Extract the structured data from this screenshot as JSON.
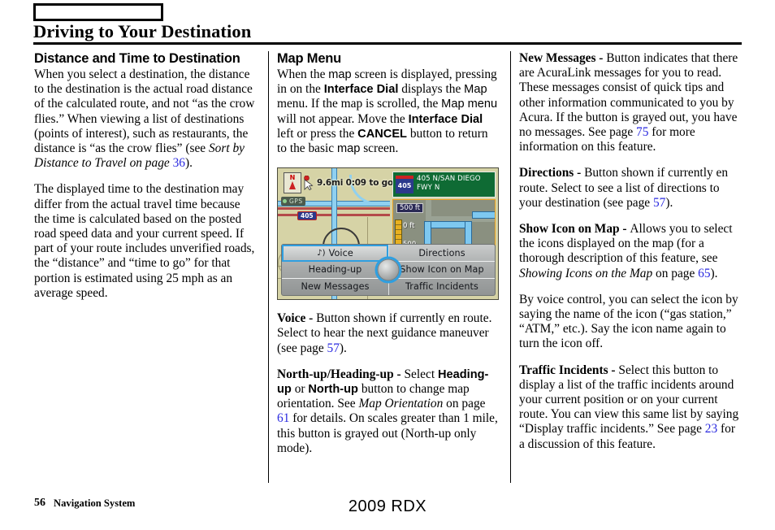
{
  "header": {
    "tab_marker_label": "",
    "title": "Driving to Your Destination"
  },
  "columns": {
    "left": {
      "heading": "Distance and Time to Destination",
      "para1_a": "When you select a destination, the distance to the destination is the actual road distance of the calculated route, and not “as the crow flies.” When viewing a list of destinations (points of interest), such as restaurants, the distance is “as the crow flies” (see ",
      "para1_italic": "Sort by Distance to Travel",
      "para1_b": " on page ",
      "para1_page": "36",
      "para1_c": ").",
      "para2": "The displayed time to the destination may differ from the actual travel time because the time is calculated based on the posted road speed data and your current speed. If part of your route includes unverified roads, the “distance” and “time to go” for that portion is estimated using 25 mph as an average speed."
    },
    "middle": {
      "heading": "Map Menu",
      "intro_1": "When the ",
      "intro_map1": "map",
      "intro_2": " screen is displayed, pressing in on the ",
      "intro_dial1": "Interface Dial",
      "intro_3": " displays the ",
      "intro_map2": "Map",
      "intro_4": " menu. If the map is scrolled, the ",
      "intro_map3": "Map menu",
      "intro_5": " will not appear. Move the ",
      "intro_dial2": "Interface Dial",
      "intro_6": " left or press the ",
      "intro_cancel": "CANCEL",
      "intro_7": " button to return to the basic ",
      "intro_map4": "map",
      "intro_8": " screen.",
      "voice_label": "Voice - ",
      "voice_text_a": "Button shown if currently en route. Select to hear the next guidance maneuver (see page ",
      "voice_page": "57",
      "voice_text_b": ").",
      "northup_label": "North-up/Heading-up - ",
      "northup_a": "Select ",
      "northup_b1": "Heading-up",
      "northup_c": " or ",
      "northup_b2": "North-up",
      "northup_d": " button to change map orientation. See ",
      "northup_italic": "Map Orientation",
      "northup_e": " on page ",
      "northup_page": "61",
      "northup_f": " for details. On scales greater than 1 mile, this button is grayed out (North-up only mode)."
    },
    "right": {
      "newmsg_label": "New Messages - ",
      "newmsg_a": "Button indicates that there are AcuraLink messages for you to read. These messages consist of quick tips and other information communicated to you by Acura. If the button is grayed out, you have no messages. See page ",
      "newmsg_page": "75",
      "newmsg_b": " for more information on this feature.",
      "directions_label": "Directions - ",
      "directions_a": "Button shown if currently en route. Select to see a list of directions to your destination (see page ",
      "directions_page": "57",
      "directions_b": ").",
      "showicon_label": "Show Icon on Map - ",
      "showicon_a": "Allows you to select the icons displayed on the map (for a thorough description of this feature, see ",
      "showicon_italic": "Showing Icons on the Map",
      "showicon_b": " on page ",
      "showicon_page": "65",
      "showicon_c": ").",
      "voicecontrol": "By voice control, you can select the icon by saying the name of the icon (“gas station,” “ATM,” etc.). Say the icon name again to turn the icon off.",
      "traffic_label": "Traffic Incidents - ",
      "traffic_a": "Select this button to display a list of the traffic incidents around your current position or on your current route. You can view this same list by saying “Display traffic incidents.” See page ",
      "traffic_page": "23",
      "traffic_b": " for a discussion of this feature."
    }
  },
  "nav_screen": {
    "compass_letter": "N",
    "gps_label": "GPS",
    "eta_text": "9.6mi 0:09 to go",
    "map_shield": "405",
    "banner_shield": "405",
    "banner_text": "405 N/SAN DIEGO FWY N",
    "inset_scale_top": "500 ft",
    "inset_scale_zero": "0 ft",
    "inset_scale_bottom": "500",
    "buttons": [
      {
        "label": "Voice",
        "icon": "speaker-icon",
        "selected": true
      },
      {
        "label": "Directions",
        "icon": null,
        "selected": false
      },
      {
        "label": "Heading-up",
        "icon": null,
        "selected": false
      },
      {
        "label": "Show Icon on Map",
        "icon": null,
        "selected": false
      },
      {
        "label": "New Messages",
        "icon": null,
        "selected": false
      },
      {
        "label": "Traffic Incidents",
        "icon": null,
        "selected": false
      }
    ]
  },
  "footer": {
    "page_number": "56",
    "section_name": "Navigation System",
    "model": "2009  RDX"
  },
  "colors": {
    "page_link": "#2a2ae0",
    "map_background": "#d6d3a6",
    "banner_green": "#0f6b34",
    "highlight_blue": "#2f9fe0",
    "inset_border": "#e8a020"
  }
}
